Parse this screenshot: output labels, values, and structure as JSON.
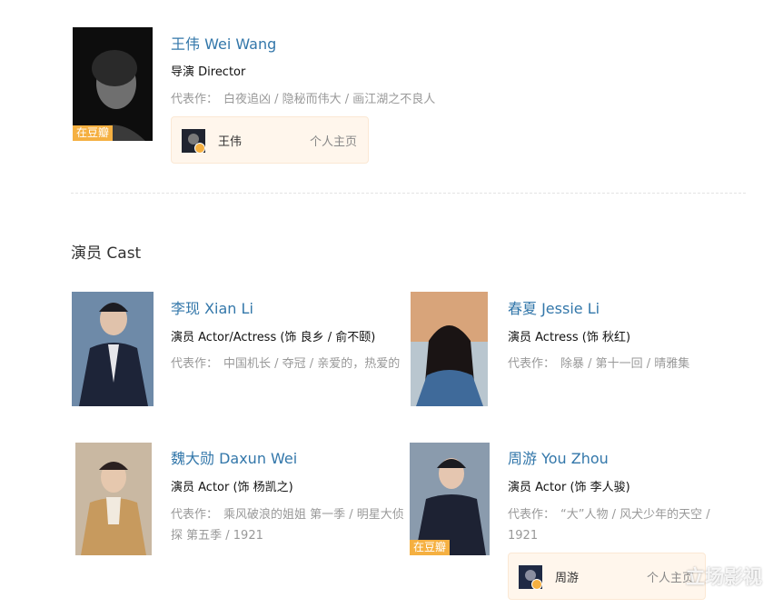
{
  "director": {
    "name": "王伟 Wei Wang",
    "role": "导演 Director",
    "works_label": "代表作：",
    "works": "白夜追凶 / 隐秘而伟大 / 画江湖之不良人",
    "tag": "在豆瓣",
    "card": {
      "name": "王伟",
      "home_label": "个人主页"
    }
  },
  "cast_section": {
    "title": "演员 Cast"
  },
  "cast": [
    {
      "name": "李现 Xian Li",
      "role": "演员 Actor/Actress (饰 良乡 / 俞不颐)",
      "works_label": "代表作：",
      "works": "中国机长 / 夺冠 / 亲爱的，热爱的"
    },
    {
      "name": "春夏 Jessie Li",
      "role": "演员 Actress (饰 秋红)",
      "works_label": "代表作：",
      "works": "除暴 / 第十一回 / 晴雅集"
    },
    {
      "name": "魏大勋 Daxun Wei",
      "role": "演员 Actor (饰 杨凯之)",
      "works_label": "代表作：",
      "works": "乘风破浪的姐姐 第一季 / 明星大侦探 第五季 / 1921"
    },
    {
      "name": "周游 You Zhou",
      "role": "演员 Actor (饰 李人骏)",
      "works_label": "代表作：",
      "works": "“大”人物 / 风犬少年的天空 / 1921",
      "tag": "在豆瓣",
      "card": {
        "name": "周游",
        "home_label": "个人主页"
      }
    }
  ],
  "watermark": "立场影视"
}
